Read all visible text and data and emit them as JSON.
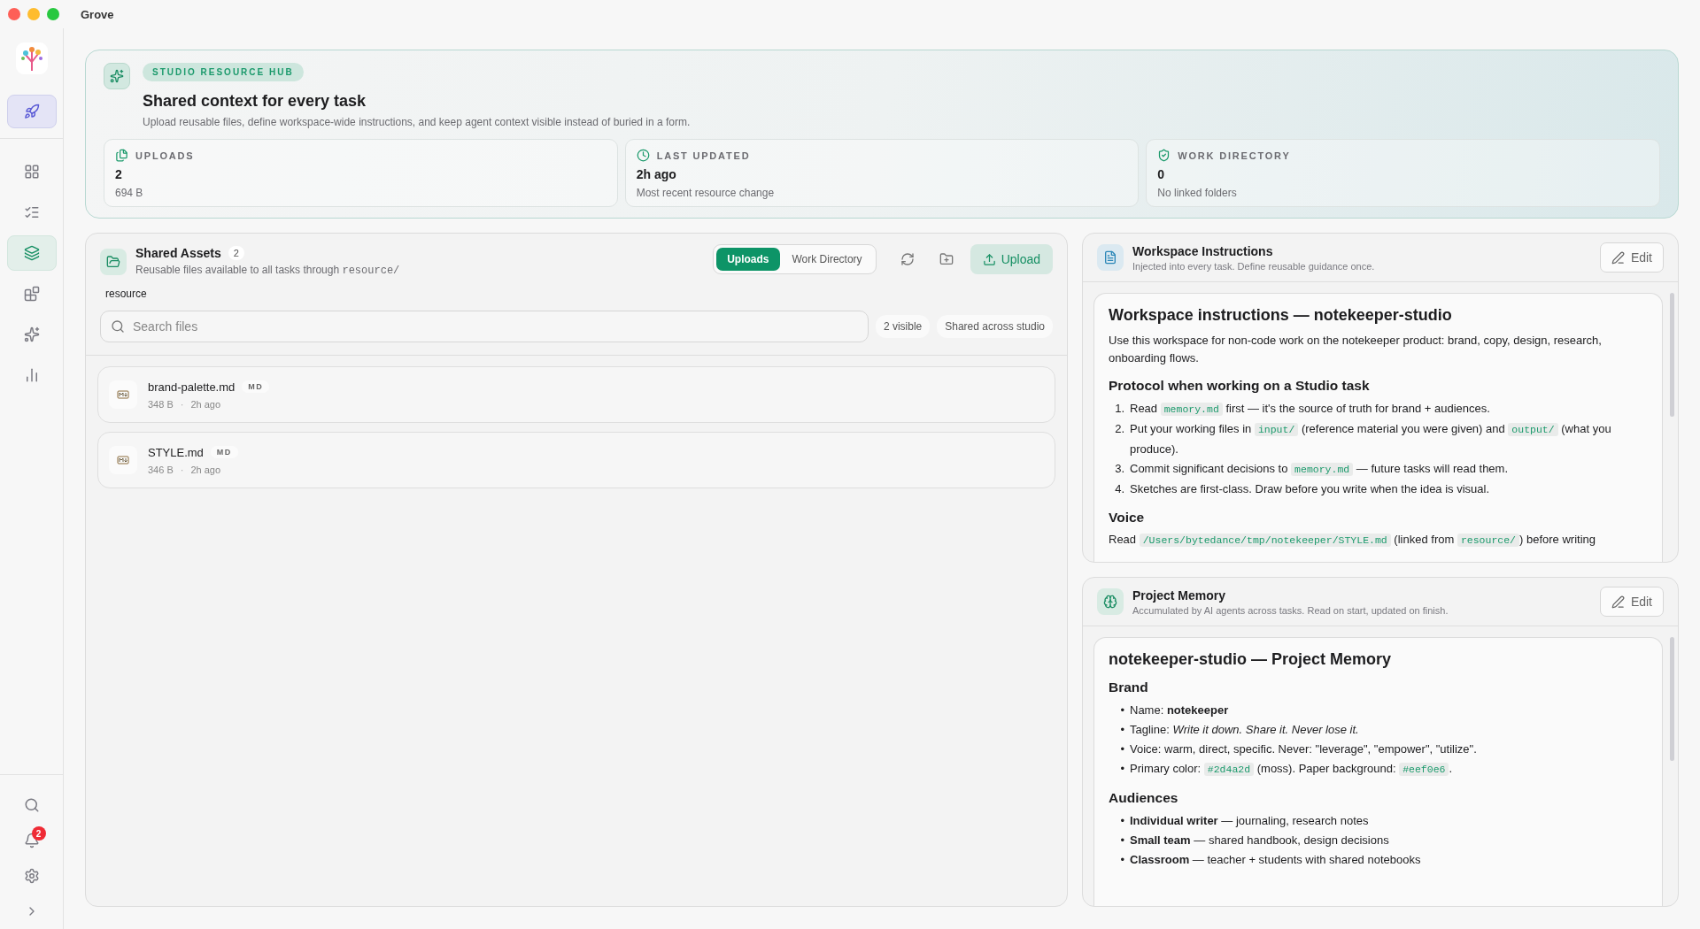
{
  "window": {
    "title": "Grove"
  },
  "sidebar": {
    "top_items": [
      {
        "selected": true
      }
    ],
    "items": [
      {
        "selected": false
      },
      {
        "selected": false
      },
      {
        "selected": true
      },
      {
        "selected": false
      },
      {
        "selected": false
      },
      {
        "selected": false
      }
    ],
    "notifications": "2"
  },
  "hero": {
    "badge": "STUDIO RESOURCE HUB",
    "title": "Shared context for every task",
    "description": "Upload reusable files, define workspace-wide instructions, and keep agent context visible instead of buried in a form.",
    "stats": [
      {
        "label": "UPLOADS",
        "value": "2",
        "detail": "694 B"
      },
      {
        "label": "LAST UPDATED",
        "value": "2h ago",
        "detail": "Most recent resource change"
      },
      {
        "label": "WORK DIRECTORY",
        "value": "0",
        "detail": "No linked folders"
      }
    ]
  },
  "assets": {
    "title": "Shared Assets",
    "count": "2",
    "subtitle": "Reusable files available to all tasks through ",
    "subtitle_code": "resource/",
    "tabs": [
      {
        "label": "Uploads",
        "selected": true
      },
      {
        "label": "Work Directory",
        "selected": false
      }
    ],
    "upload_button": "Upload",
    "path": "resource",
    "search": {
      "placeholder": "Search files"
    },
    "chips": [
      "2 visible",
      "Shared across studio"
    ],
    "files": [
      {
        "name": "brand-palette.md",
        "type": "MD",
        "size": "348 B",
        "separator": "·",
        "time": "2h ago"
      },
      {
        "name": "STYLE.md",
        "type": "MD",
        "size": "346 B",
        "separator": "·",
        "time": "2h ago"
      }
    ]
  },
  "panels": [
    {
      "title": "Workspace Instructions",
      "subtitle": "Injected into every task. Define reusable guidance once.",
      "edit": "Edit",
      "content": [
        {
          "kind": "h1",
          "parts": [
            {
              "kind": "text",
              "text": "Workspace instructions — notekeeper-studio"
            }
          ]
        },
        {
          "kind": "p",
          "parts": [
            {
              "kind": "text",
              "text": "Use this workspace for non-code work on the notekeeper product: brand, copy, design, research, onboarding flows."
            }
          ]
        },
        {
          "kind": "h2",
          "parts": [
            {
              "kind": "text",
              "text": "Protocol when working on a Studio task"
            }
          ]
        },
        {
          "kind": "list",
          "items": [
            {
              "marker": "1.",
              "parts": [
                {
                  "kind": "text",
                  "text": "Read "
                },
                {
                  "kind": "code",
                  "text": "memory.md"
                },
                {
                  "kind": "text",
                  "text": " first — it's the source of truth for brand + audiences."
                }
              ]
            },
            {
              "marker": "2.",
              "parts": [
                {
                  "kind": "text",
                  "text": "Put your working files in "
                },
                {
                  "kind": "code",
                  "text": "input/"
                },
                {
                  "kind": "text",
                  "text": " (reference material you were given) and "
                },
                {
                  "kind": "code",
                  "text": "output/"
                },
                {
                  "kind": "text",
                  "text": " (what you produce)."
                }
              ]
            },
            {
              "marker": "3.",
              "parts": [
                {
                  "kind": "text",
                  "text": "Commit significant decisions to "
                },
                {
                  "kind": "code",
                  "text": "memory.md"
                },
                {
                  "kind": "text",
                  "text": " — future tasks will read them."
                }
              ]
            },
            {
              "marker": "4.",
              "parts": [
                {
                  "kind": "text",
                  "text": "Sketches are first-class. Draw before you write when the idea is visual."
                }
              ]
            }
          ]
        },
        {
          "kind": "h2",
          "parts": [
            {
              "kind": "text",
              "text": "Voice"
            }
          ]
        },
        {
          "kind": "p",
          "parts": [
            {
              "kind": "text",
              "text": "Read "
            },
            {
              "kind": "code",
              "text": "/Users/bytedance/tmp/notekeeper/STYLE.md"
            },
            {
              "kind": "text",
              "text": " (linked from "
            },
            {
              "kind": "code",
              "text": "resource/"
            },
            {
              "kind": "text",
              "text": ") before writing"
            }
          ]
        }
      ]
    },
    {
      "title": "Project Memory",
      "subtitle": "Accumulated by AI agents across tasks. Read on start, updated on finish.",
      "edit": "Edit",
      "content": [
        {
          "kind": "h1",
          "parts": [
            {
              "kind": "text",
              "text": "notekeeper-studio — Project Memory"
            }
          ]
        },
        {
          "kind": "h2",
          "parts": [
            {
              "kind": "text",
              "text": "Brand"
            }
          ]
        },
        {
          "kind": "list",
          "items": [
            {
              "marker": "•",
              "parts": [
                {
                  "kind": "text",
                  "text": "Name: **notekeeper**"
                }
              ]
            },
            {
              "marker": "•",
              "parts": [
                {
                  "kind": "text",
                  "text": "Tagline: *Write it down. Share it. Never lose it.*"
                }
              ]
            },
            {
              "marker": "•",
              "parts": [
                {
                  "kind": "text",
                  "text": "Voice: warm, direct, specific. Never: \"leverage\", \"empower\", \"utilize\"."
                }
              ]
            },
            {
              "marker": "•",
              "parts": [
                {
                  "kind": "text",
                  "text": "Primary color: "
                },
                {
                  "kind": "code",
                  "text": "#2d4a2d"
                },
                {
                  "kind": "text",
                  "text": " (moss). Paper background: "
                },
                {
                  "kind": "code",
                  "text": "#eef0e6"
                },
                {
                  "kind": "text",
                  "text": "."
                }
              ]
            }
          ]
        },
        {
          "kind": "h2",
          "parts": [
            {
              "kind": "text",
              "text": "Audiences"
            }
          ]
        },
        {
          "kind": "list",
          "items": [
            {
              "marker": "•",
              "parts": [
                {
                  "kind": "text",
                  "text": "**Individual writer** — journaling, research notes"
                }
              ]
            },
            {
              "marker": "•",
              "parts": [
                {
                  "kind": "text",
                  "text": "**Small team** — shared handbook, design decisions"
                }
              ]
            },
            {
              "marker": "•",
              "parts": [
                {
                  "kind": "text",
                  "text": "**Classroom** — teacher + students with shared notebooks"
                }
              ]
            }
          ]
        }
      ]
    }
  ]
}
